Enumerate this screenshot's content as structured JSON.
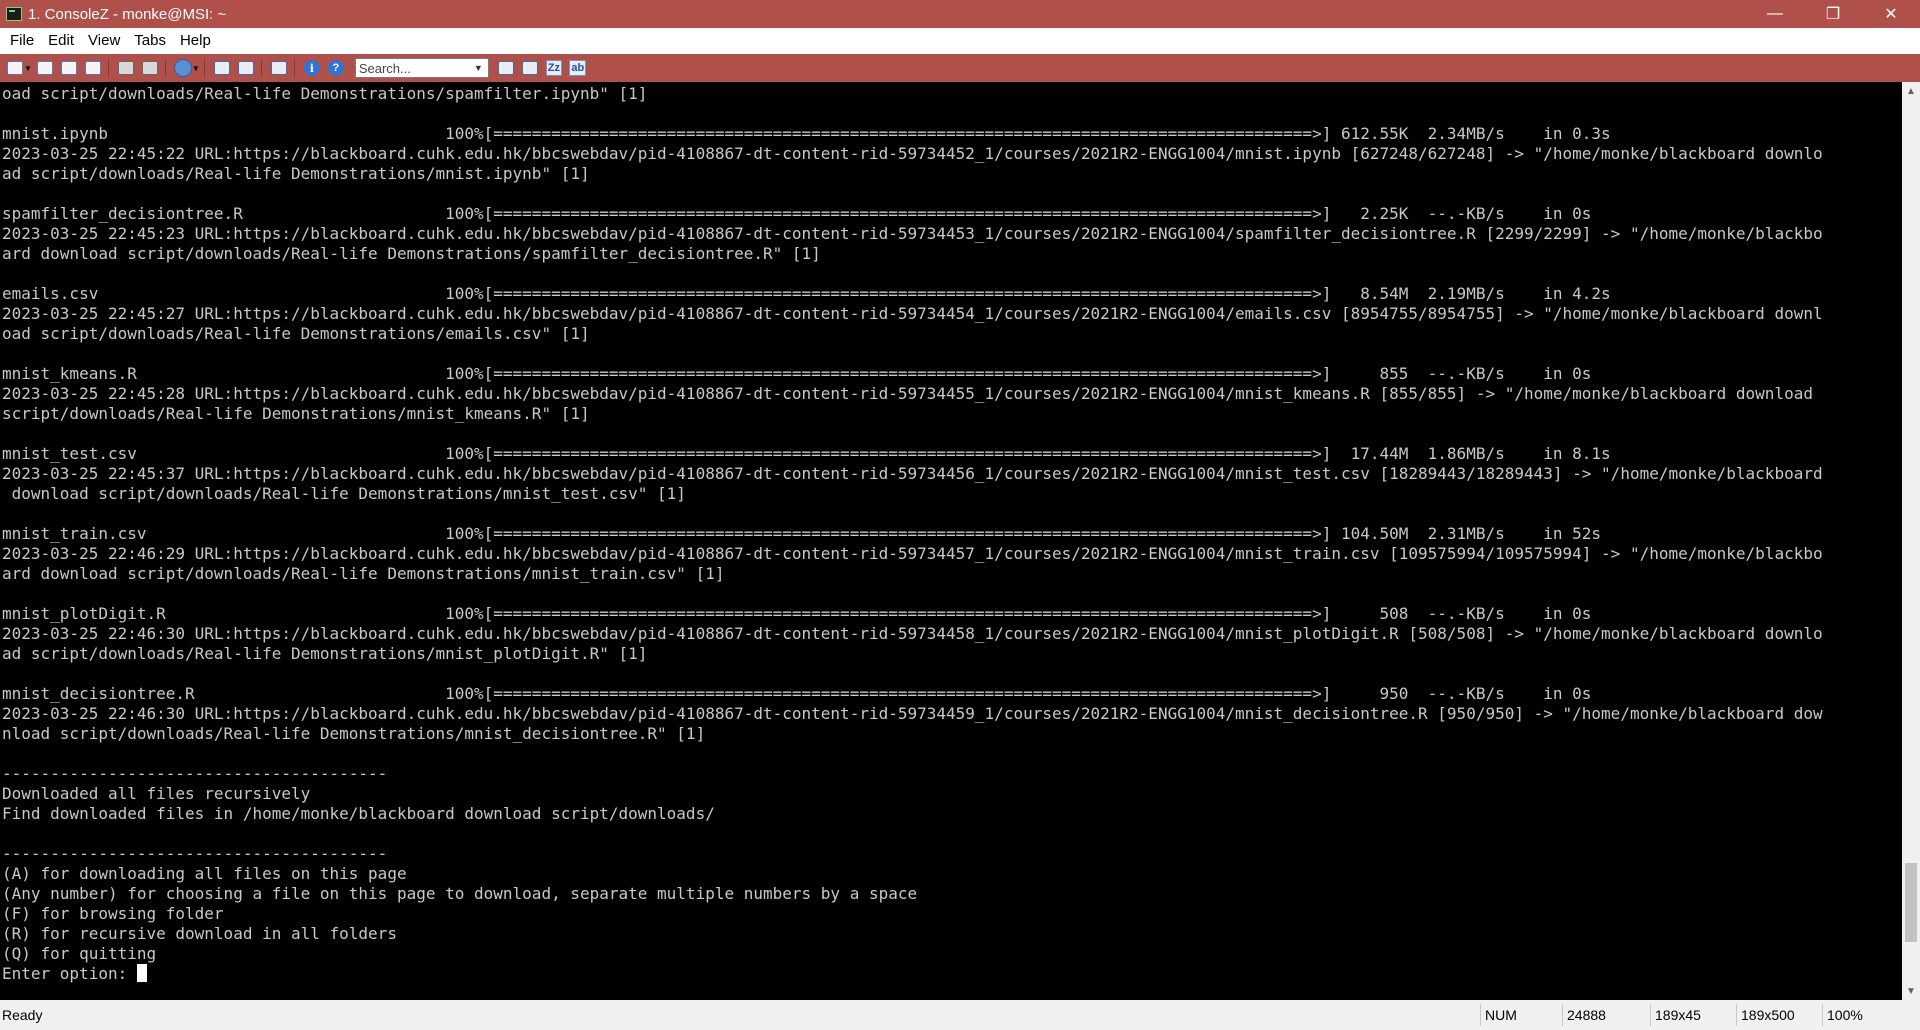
{
  "window": {
    "title": "1. ConsoleZ - monke@MSI: ~",
    "controls": {
      "minimize": "—",
      "restore": "❐",
      "close": "✕"
    }
  },
  "menu": {
    "items": [
      "File",
      "Edit",
      "View",
      "Tabs",
      "Help"
    ]
  },
  "toolbar": {
    "search_placeholder": "Search...",
    "icons": [
      "new-tab-icon",
      "new-tab-dropdown-icon",
      "new-window-icon",
      "clone-tab-icon",
      "close-tab-icon",
      "copy-icon",
      "paste-icon",
      "globe-icon",
      "rename-tab-icon",
      "detach-tab-icon",
      "settings-icon",
      "info-icon",
      "help-icon"
    ],
    "search_buttons": [
      "prev-match-icon",
      "next-match-icon",
      "match-case-icon",
      "match-whole-word-icon"
    ],
    "match_case_label": "Zz",
    "whole_word_label": "ab"
  },
  "terminal": {
    "lines": [
      "oad script/downloads/Real-life Demonstrations/spamfilter.ipynb\" [1]",
      "",
      "mnist.ipynb                                   100%[=====================================================================================>] 612.55K  2.34MB/s    in 0.3s",
      "2023-03-25 22:45:22 URL:https://blackboard.cuhk.edu.hk/bbcswebdav/pid-4108867-dt-content-rid-59734452_1/courses/2021R2-ENGG1004/mnist.ipynb [627248/627248] -> \"/home/monke/blackboard downlo",
      "ad script/downloads/Real-life Demonstrations/mnist.ipynb\" [1]",
      "",
      "spamfilter_decisiontree.R                     100%[=====================================================================================>]   2.25K  --.-KB/s    in 0s",
      "2023-03-25 22:45:23 URL:https://blackboard.cuhk.edu.hk/bbcswebdav/pid-4108867-dt-content-rid-59734453_1/courses/2021R2-ENGG1004/spamfilter_decisiontree.R [2299/2299] -> \"/home/monke/blackbo",
      "ard download script/downloads/Real-life Demonstrations/spamfilter_decisiontree.R\" [1]",
      "",
      "emails.csv                                    100%[=====================================================================================>]   8.54M  2.19MB/s    in 4.2s",
      "2023-03-25 22:45:27 URL:https://blackboard.cuhk.edu.hk/bbcswebdav/pid-4108867-dt-content-rid-59734454_1/courses/2021R2-ENGG1004/emails.csv [8954755/8954755] -> \"/home/monke/blackboard downl",
      "oad script/downloads/Real-life Demonstrations/emails.csv\" [1]",
      "",
      "mnist_kmeans.R                                100%[=====================================================================================>]     855  --.-KB/s    in 0s",
      "2023-03-25 22:45:28 URL:https://blackboard.cuhk.edu.hk/bbcswebdav/pid-4108867-dt-content-rid-59734455_1/courses/2021R2-ENGG1004/mnist_kmeans.R [855/855] -> \"/home/monke/blackboard download",
      "script/downloads/Real-life Demonstrations/mnist_kmeans.R\" [1]",
      "",
      "mnist_test.csv                                100%[=====================================================================================>]  17.44M  1.86MB/s    in 8.1s",
      "2023-03-25 22:45:37 URL:https://blackboard.cuhk.edu.hk/bbcswebdav/pid-4108867-dt-content-rid-59734456_1/courses/2021R2-ENGG1004/mnist_test.csv [18289443/18289443] -> \"/home/monke/blackboard",
      " download script/downloads/Real-life Demonstrations/mnist_test.csv\" [1]",
      "",
      "mnist_train.csv                               100%[=====================================================================================>] 104.50M  2.31MB/s    in 52s",
      "2023-03-25 22:46:29 URL:https://blackboard.cuhk.edu.hk/bbcswebdav/pid-4108867-dt-content-rid-59734457_1/courses/2021R2-ENGG1004/mnist_train.csv [109575994/109575994] -> \"/home/monke/blackbo",
      "ard download script/downloads/Real-life Demonstrations/mnist_train.csv\" [1]",
      "",
      "mnist_plotDigit.R                             100%[=====================================================================================>]     508  --.-KB/s    in 0s",
      "2023-03-25 22:46:30 URL:https://blackboard.cuhk.edu.hk/bbcswebdav/pid-4108867-dt-content-rid-59734458_1/courses/2021R2-ENGG1004/mnist_plotDigit.R [508/508] -> \"/home/monke/blackboard downlo",
      "ad script/downloads/Real-life Demonstrations/mnist_plotDigit.R\" [1]",
      "",
      "mnist_decisiontree.R                          100%[=====================================================================================>]     950  --.-KB/s    in 0s",
      "2023-03-25 22:46:30 URL:https://blackboard.cuhk.edu.hk/bbcswebdav/pid-4108867-dt-content-rid-59734459_1/courses/2021R2-ENGG1004/mnist_decisiontree.R [950/950] -> \"/home/monke/blackboard dow",
      "nload script/downloads/Real-life Demonstrations/mnist_decisiontree.R\" [1]",
      "",
      "----------------------------------------",
      "Downloaded all files recursively",
      "Find downloaded files in /home/monke/blackboard download script/downloads/",
      "",
      "----------------------------------------",
      "(A) for downloading all files on this page",
      "(Any number) for choosing a file on this page to download, separate multiple numbers by a space",
      "(F) for browsing folder",
      "(R) for recursive download in all folders",
      "(Q) for quitting"
    ],
    "prompt": "Enter option: ",
    "text_color": "#c8c8c8",
    "background_color": "#000000",
    "scroll_position": 0.95,
    "scroll_visible_fraction": 0.09
  },
  "statusbar": {
    "ready": "Ready",
    "num": "NUM",
    "pid": "24888",
    "cols_rows": "189x45",
    "buffer": "189x500",
    "zoom": "100%"
  },
  "colors": {
    "accent": "#b0504a",
    "terminal_bg": "#000000",
    "terminal_fg": "#c8c8c8",
    "statusbar_bg": "#f0f0f0"
  }
}
